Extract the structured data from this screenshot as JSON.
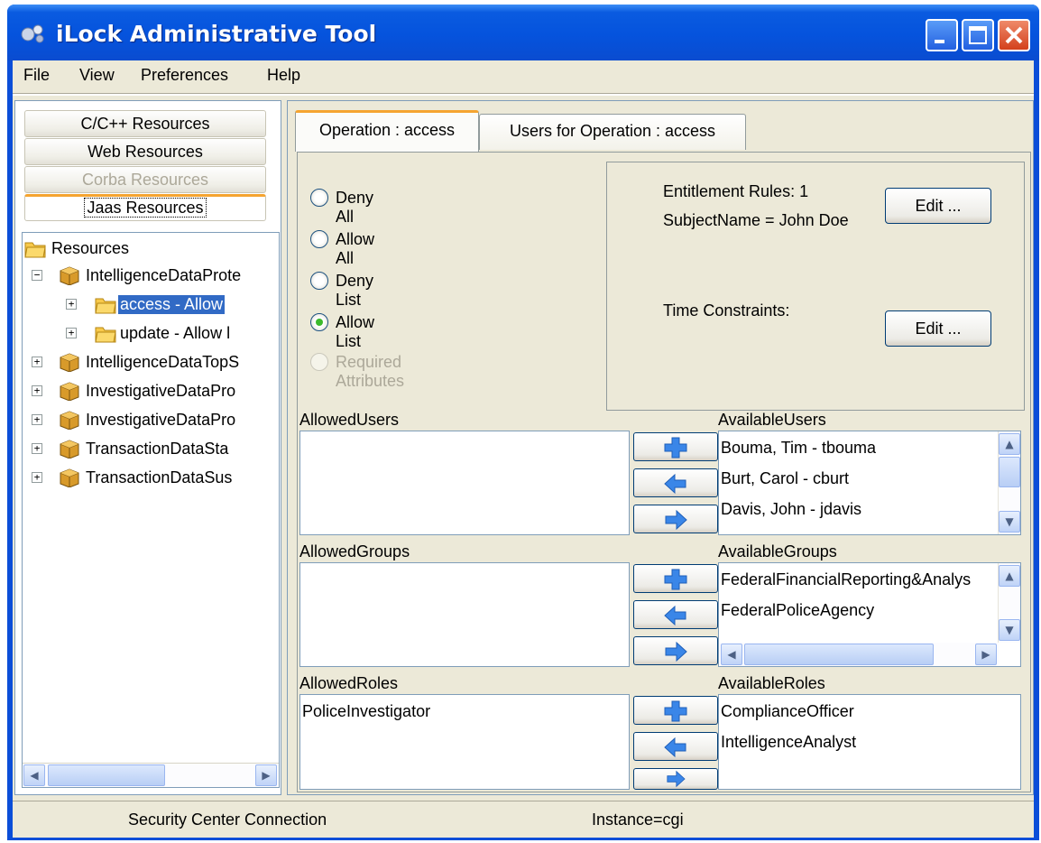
{
  "window": {
    "title": "iLock Administrative Tool"
  },
  "menu": {
    "file": "File",
    "view": "View",
    "preferences": "Preferences",
    "help": "Help"
  },
  "accordion": [
    {
      "label": "C/C++ Resources",
      "state": "normal"
    },
    {
      "label": "Web Resources",
      "state": "normal"
    },
    {
      "label": "Corba Resources",
      "state": "disabled"
    },
    {
      "label": "Jaas Resources",
      "state": "active"
    }
  ],
  "tree": {
    "root": "Resources",
    "nodes": [
      {
        "label": "IntelligenceDataProte",
        "expander": "−"
      },
      {
        "label": "access - Allow",
        "expander": "+",
        "selected": true
      },
      {
        "label": "update - Allow l",
        "expander": "+"
      },
      {
        "label": "IntelligenceDataTopS",
        "expander": "+"
      },
      {
        "label": "InvestigativeDataPro",
        "expander": "+"
      },
      {
        "label": "InvestigativeDataPro",
        "expander": "+"
      },
      {
        "label": "TransactionDataSta",
        "expander": "+"
      },
      {
        "label": "TransactionDataSus",
        "expander": "+"
      }
    ]
  },
  "tabs": [
    {
      "label": "Operation : access",
      "active": true
    },
    {
      "label": "Users for Operation : access",
      "active": false
    }
  ],
  "radios": [
    {
      "label": "Deny All",
      "checked": false,
      "disabled": false
    },
    {
      "label": "Allow All",
      "checked": false,
      "disabled": false
    },
    {
      "label": "Deny List",
      "checked": false,
      "disabled": false
    },
    {
      "label": "Allow List",
      "checked": true,
      "disabled": false
    },
    {
      "label": "Required Attributes",
      "checked": false,
      "disabled": true
    }
  ],
  "entitlement": {
    "rules_label": "Entitlement Rules:  1",
    "subject": "SubjectName = John Doe",
    "edit_label": "Edit ...",
    "time_label": "Time Constraints:",
    "time_edit_label": "Edit ..."
  },
  "users": {
    "allowed_label": "AllowedUsers",
    "available_label": "AvailableUsers",
    "allowed": [],
    "available": [
      "Bouma, Tim  - tbouma",
      "Burt, Carol  - cburt",
      "Davis, John  - jdavis"
    ]
  },
  "groups": {
    "allowed_label": "AllowedGroups",
    "available_label": "AvailableGroups",
    "allowed": [],
    "available": [
      "FederalFinancialReporting&Analys",
      "FederalPoliceAgency"
    ]
  },
  "roles": {
    "allowed_label": "AllowedRoles",
    "available_label": "AvailableRoles",
    "allowed": [
      "PoliceInvestigator"
    ],
    "available": [
      "ComplianceOfficer",
      "IntelligenceAnalyst"
    ]
  },
  "status": {
    "connection": "Security Center Connection",
    "instance": "Instance=cgi"
  },
  "colors": {
    "title_bar": "#0553dd",
    "selection": "#316ac5",
    "tab_accent": "#f5a430",
    "arrow_blue": "#3a86e8"
  }
}
